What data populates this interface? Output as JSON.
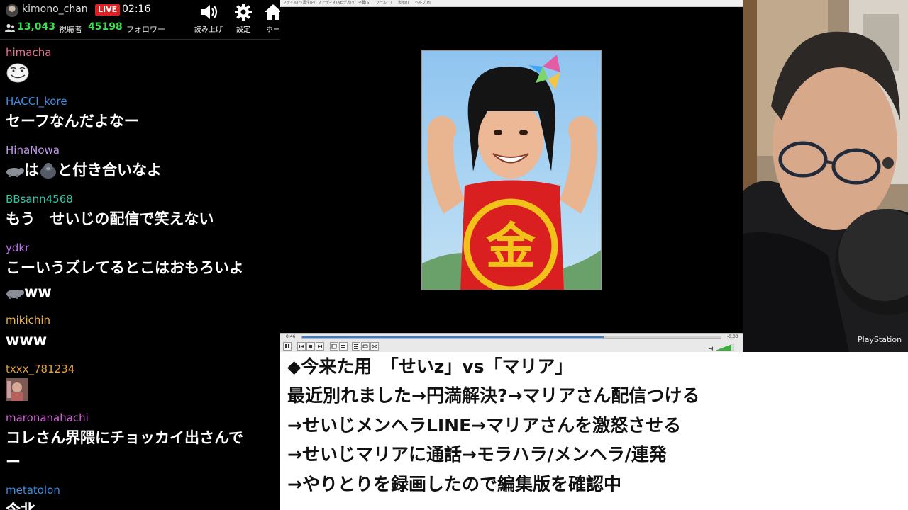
{
  "header": {
    "channel_name": "kimono_chan",
    "live_badge": "LIVE",
    "elapsed_time": "02:16",
    "viewer_count": "13,043",
    "viewer_label": "視聴者",
    "follower_count": "45198",
    "follower_label": "フォロワー",
    "buttons": [
      {
        "label": "読み上げ",
        "icon": "speaker-icon"
      },
      {
        "label": "設定",
        "icon": "gear-icon"
      },
      {
        "label": "ホー",
        "icon": "home-icon"
      }
    ]
  },
  "chat": [
    {
      "user": "himacha",
      "color": "#f0719a",
      "text": "",
      "emote": "face-emote"
    },
    {
      "user": "HACCI_kore",
      "color": "#3c8fe6",
      "text": "セーフなんだよなー"
    },
    {
      "user": "HinaNowa",
      "color": "#c39af0",
      "text": "は",
      "text2": "と付き合いなよ",
      "emote": "hippo-emote",
      "emote2": "gorilla-emote"
    },
    {
      "user": "BBsann4568",
      "color": "#2fc7a4",
      "text": "もう　せいじの配信で笑えない"
    },
    {
      "user": "ydkr",
      "color": "#b86ee8",
      "text": "こーいうズレてるとこはおもろいよ",
      "text_cont": "ww",
      "emote": "hippo-emote"
    },
    {
      "user": "mikichin",
      "color": "#f1b64a",
      "text": "www"
    },
    {
      "user": "txxx_781234",
      "color": "#e8a23a",
      "text": "",
      "emote": "thumbnail-emote"
    },
    {
      "user": "maronanahachi",
      "color": "#d066d6",
      "text": "コレさん界隈にチョッカイ出さんで",
      "text_cont": "ー"
    },
    {
      "user": "metatolon",
      "color": "#3c8fe6",
      "text": "今北"
    }
  ],
  "player": {
    "menu_items": [
      "ファイル(F)",
      "再生(P)",
      "オーディオ(A)",
      "ビデオ(V)",
      "字幕(S)",
      "ツール(T)",
      "表示(I)",
      "ヘルプ(H)"
    ],
    "progress": 0.72,
    "time_left": "0:46",
    "time_right": "-0:00",
    "volume": "100%"
  },
  "photo": {
    "badge_text": "金"
  },
  "webcam": {
    "brand_text": "PlayStation"
  },
  "caption": {
    "lines": [
      "◆今来た用　「せいz」vs「マリア」",
      "最近別れました→円満解決?→マリアさん配信つける",
      "→せいじメンヘラLINE→マリアさんを激怒させる",
      "→せいじマリアに通話→モラハラ/メンヘラ/連発",
      "→やりとりを録画したので編集版を確認中"
    ]
  }
}
